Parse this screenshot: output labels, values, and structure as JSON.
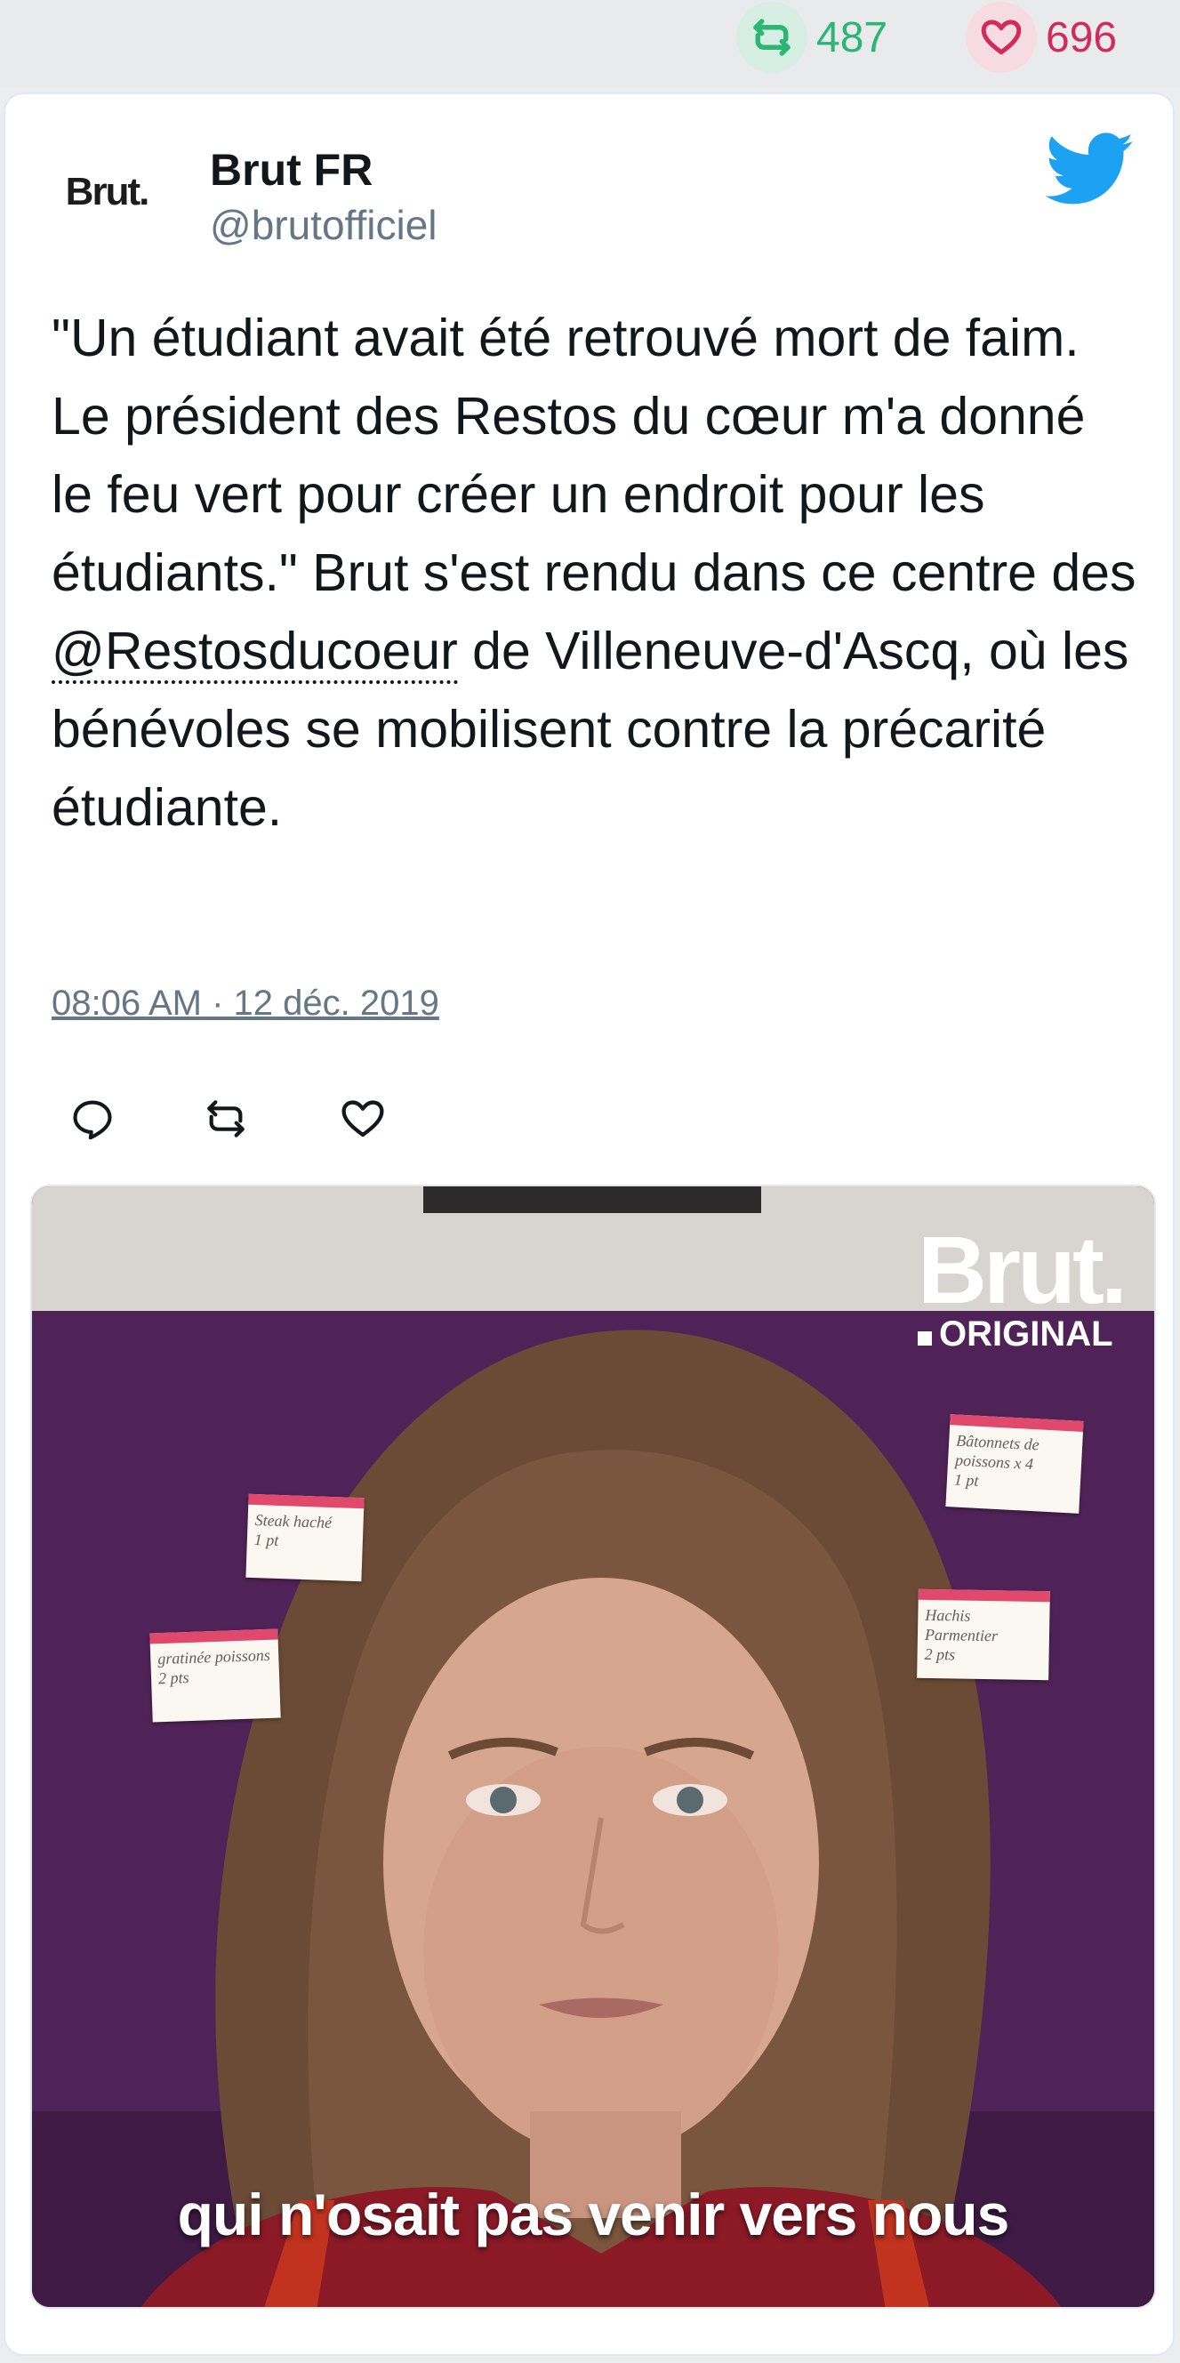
{
  "stats": {
    "retweets": "487",
    "likes": "696",
    "retweet_color": "#2bb673",
    "like_color": "#d22a5a"
  },
  "author": {
    "avatar_text": "Brut.",
    "name": "Brut FR",
    "handle": "@brutofficiel"
  },
  "tweet": {
    "text_before": "\"Un étudiant avait été retrouvé mort de faim. Le président des Restos du cœur m'a donné le feu vert pour créer un endroit pour les étudiants.\" Brut s'est rendu dans ce centre des ",
    "mention": "@Restosducoeur",
    "text_after": " de Villeneuve-d'Ascq, où les bénévoles se mobilisent contre la précarité étudiante.",
    "timestamp": "08:06 AM · 12 déc. 2019"
  },
  "actions": {
    "icons": [
      "reply-icon",
      "retweet-icon",
      "like-icon"
    ]
  },
  "media": {
    "brand_word": "Brut.",
    "brand_sub": "ORIGINAL",
    "caption": "qui n'osait pas venir vers nous",
    "notes": [
      "Steak haché\n1 pt",
      "gratinée poissons\n2 pts",
      "Bâtonnets de poissons x 4\n1 pt",
      "Hachis Parmentier\n2 pts"
    ]
  },
  "colors": {
    "twitter_blue": "#1da1f2",
    "text": "#14171a",
    "muted": "#657786"
  }
}
